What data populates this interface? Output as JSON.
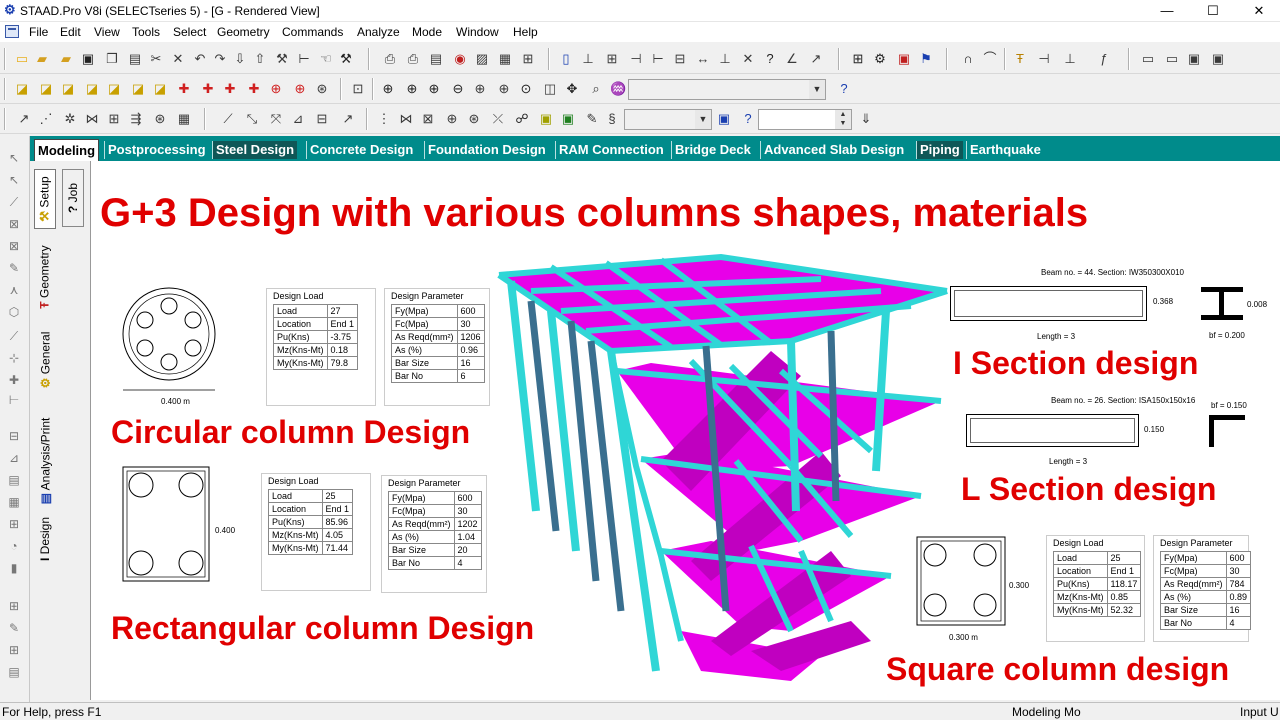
{
  "window": {
    "title": "STAAD.Pro V8i (SELECTseries 5) - [G - Rendered View]",
    "minimize": "—",
    "maximize": "☐",
    "close": "✕"
  },
  "menu": [
    "File",
    "Edit",
    "View",
    "Tools",
    "Select",
    "Geometry",
    "Commands",
    "Analyze",
    "Mode",
    "Window",
    "Help"
  ],
  "tabs": [
    "Modeling",
    "Postprocessing",
    "Steel Design",
    "Concrete Design",
    "Foundation Design",
    "RAM Connection",
    "Bridge Deck",
    "Advanced Slab Design",
    "Piping",
    "Earthquake"
  ],
  "vertical_tabs": {
    "job": "Job",
    "setup": "Setup",
    "geometry": "Geometry",
    "general": "General",
    "analysis": "Analysis/Print",
    "design": "Design"
  },
  "headline": "G+3 Design with various columns shapes, materials",
  "captions": {
    "circular": "Circular column Design",
    "rectangular": "Rectangular column Design",
    "i_section": "I Section design",
    "l_section": "L Section design",
    "square": "Square column design"
  },
  "circular": {
    "dim": "0.400 m",
    "load_title": "Design Load",
    "load_rows": [
      [
        "Load",
        "27"
      ],
      [
        "Location",
        "End 1"
      ],
      [
        "Pu(Kns)",
        "-3.75"
      ],
      [
        "Mz(Kns-Mt)",
        "0.18"
      ],
      [
        "My(Kns-Mt)",
        "79.8"
      ]
    ],
    "param_title": "Design Parameter",
    "param_rows": [
      [
        "Fy(Mpa)",
        "600"
      ],
      [
        "Fc(Mpa)",
        "30"
      ],
      [
        "As Reqd(mm²)",
        "1206"
      ],
      [
        "As (%)",
        "0.96"
      ],
      [
        "Bar Size",
        "16"
      ],
      [
        "Bar No",
        "6"
      ]
    ]
  },
  "rectangular": {
    "dim": "0.400",
    "load_title": "Design Load",
    "load_rows": [
      [
        "Load",
        "25"
      ],
      [
        "Location",
        "End 1"
      ],
      [
        "Pu(Kns)",
        "85.96"
      ],
      [
        "Mz(Kns-Mt)",
        "4.05"
      ],
      [
        "My(Kns-Mt)",
        "71.44"
      ]
    ],
    "param_title": "Design Parameter",
    "param_rows": [
      [
        "Fy(Mpa)",
        "600"
      ],
      [
        "Fc(Mpa)",
        "30"
      ],
      [
        "As Reqd(mm²)",
        "1202"
      ],
      [
        "As (%)",
        "1.04"
      ],
      [
        "Bar Size",
        "20"
      ],
      [
        "Bar No",
        "4"
      ]
    ]
  },
  "i_section": {
    "caption": "Beam no. = 44. Section: IW350300X010",
    "depth": "0.368",
    "length": "Length = 3",
    "web": "0.008",
    "flange": "bf = 0.200"
  },
  "l_section": {
    "caption": "Beam no. = 26. Section: ISA150x150x16",
    "depth": "0.150",
    "length": "Length = 3",
    "flange": "bf = 0.150"
  },
  "square": {
    "depth": "0.300",
    "width": "0.300 m",
    "load_title": "Design Load",
    "load_rows": [
      [
        "Load",
        "25"
      ],
      [
        "Location",
        "End 1"
      ],
      [
        "Pu(Kns)",
        "118.17"
      ],
      [
        "Mz(Kns-Mt)",
        "0.85"
      ],
      [
        "My(Kns-Mt)",
        "52.32"
      ]
    ],
    "param_title": "Design Parameter",
    "param_rows": [
      [
        "Fy(Mpa)",
        "600"
      ],
      [
        "Fc(Mpa)",
        "30"
      ],
      [
        "As Reqd(mm²)",
        "784"
      ],
      [
        "As (%)",
        "0.89"
      ],
      [
        "Bar Size",
        "16"
      ],
      [
        "Bar No",
        "4"
      ]
    ]
  },
  "status": {
    "help": "For Help, press F1",
    "mode": "Modeling Mo",
    "input": "Input U"
  },
  "toolbar_icons": {
    "row1": [
      "new-file-icon",
      "open-file-icon",
      "open-folder-icon",
      "save-icon",
      "copy-icon",
      "paste-icon",
      "cut-icon",
      "delete-icon",
      "undo-icon",
      "redo-icon",
      "import-icon",
      "print-icon",
      "help-icon"
    ],
    "row2": [
      "cube-icon",
      "node-icon",
      "beam-icon",
      "plate-icon",
      "solid-icon",
      "zoom-in-icon",
      "zoom-out-icon",
      "pan-icon",
      "magnify-icon"
    ],
    "row3": [
      "rotate-icon",
      "translate-icon",
      "mirror-icon",
      "grid-icon",
      "snap-icon",
      "measure-icon"
    ]
  },
  "colors": {
    "tab_bar": "#008b8b",
    "headline": "#e00000",
    "frame": "#2fd6d6",
    "slab": "#e800e8",
    "column_dark": "#3a6f8f"
  }
}
